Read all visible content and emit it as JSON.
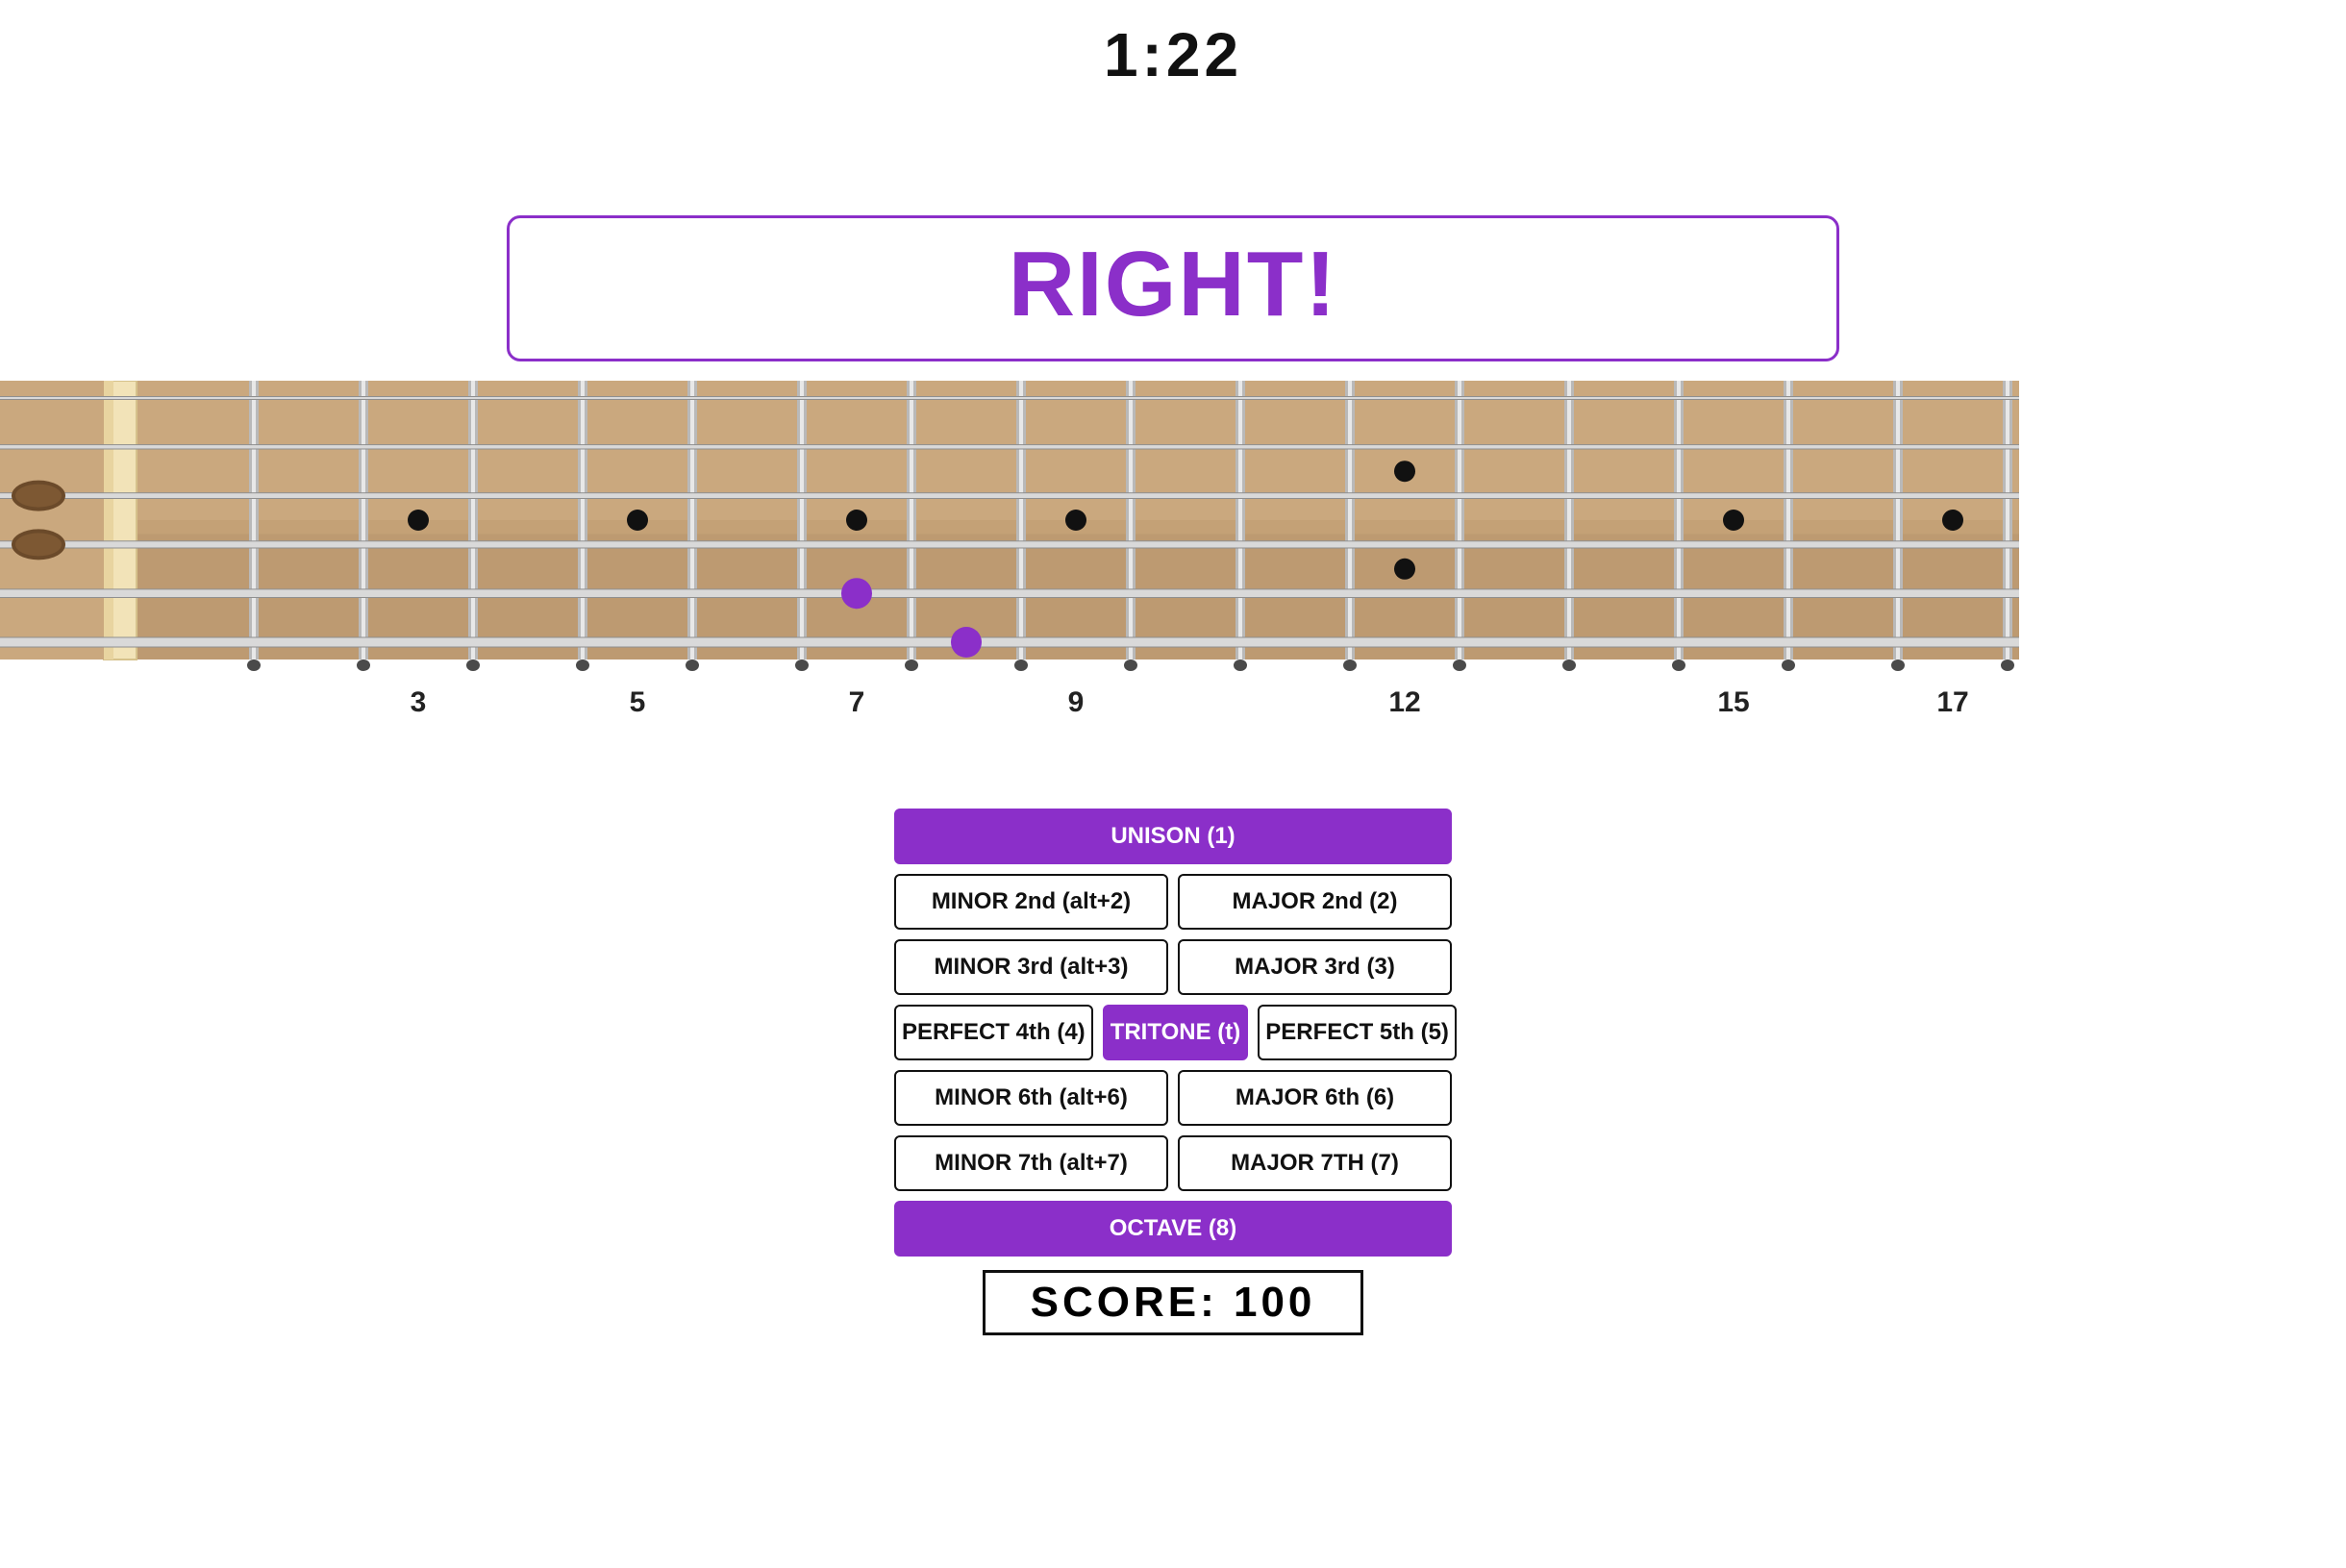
{
  "timer": "1:22",
  "feedback": "RIGHT!",
  "score_label": "SCORE:",
  "score_value": "100",
  "fretboard": {
    "strings": 6,
    "frets_shown": 18,
    "fret_labels": [
      {
        "fret": 3,
        "text": "3"
      },
      {
        "fret": 5,
        "text": "5"
      },
      {
        "fret": 7,
        "text": "7"
      },
      {
        "fret": 9,
        "text": "9"
      },
      {
        "fret": 12,
        "text": "12"
      },
      {
        "fret": 15,
        "text": "15"
      },
      {
        "fret": 17,
        "text": "17"
      }
    ],
    "inlay_dots": [
      {
        "fret": 3,
        "string_between": [
          3,
          4
        ]
      },
      {
        "fret": 5,
        "string_between": [
          3,
          4
        ]
      },
      {
        "fret": 7,
        "string_between": [
          3,
          4
        ]
      },
      {
        "fret": 9,
        "string_between": [
          3,
          4
        ]
      },
      {
        "fret": 12,
        "string_between": [
          2,
          3
        ]
      },
      {
        "fret": 12,
        "string_between": [
          4,
          5
        ]
      },
      {
        "fret": 15,
        "string_between": [
          3,
          4
        ]
      },
      {
        "fret": 17,
        "string_between": [
          3,
          4
        ]
      }
    ],
    "active_notes": [
      {
        "fret": 7,
        "string": 5,
        "color": "#8b2fc9"
      },
      {
        "fret": 8,
        "string": 6,
        "color": "#8b2fc9"
      }
    ]
  },
  "interval_buttons": [
    [
      {
        "label": "UNISON (1)",
        "selected": true
      }
    ],
    [
      {
        "label": "MINOR 2nd (alt+2)",
        "selected": false
      },
      {
        "label": "MAJOR 2nd (2)",
        "selected": false
      }
    ],
    [
      {
        "label": "MINOR 3rd (alt+3)",
        "selected": false
      },
      {
        "label": "MAJOR 3rd (3)",
        "selected": false
      }
    ],
    [
      {
        "label": "PERFECT 4th (4)",
        "selected": false
      },
      {
        "label": "TRITONE (t)",
        "selected": true
      },
      {
        "label": "PERFECT 5th (5)",
        "selected": false
      }
    ],
    [
      {
        "label": "MINOR 6th (alt+6)",
        "selected": false
      },
      {
        "label": "MAJOR 6th (6)",
        "selected": false
      }
    ],
    [
      {
        "label": "MINOR 7th (alt+7)",
        "selected": false
      },
      {
        "label": "MAJOR 7TH (7)",
        "selected": false
      }
    ],
    [
      {
        "label": "OCTAVE (8)",
        "selected": true
      }
    ]
  ]
}
